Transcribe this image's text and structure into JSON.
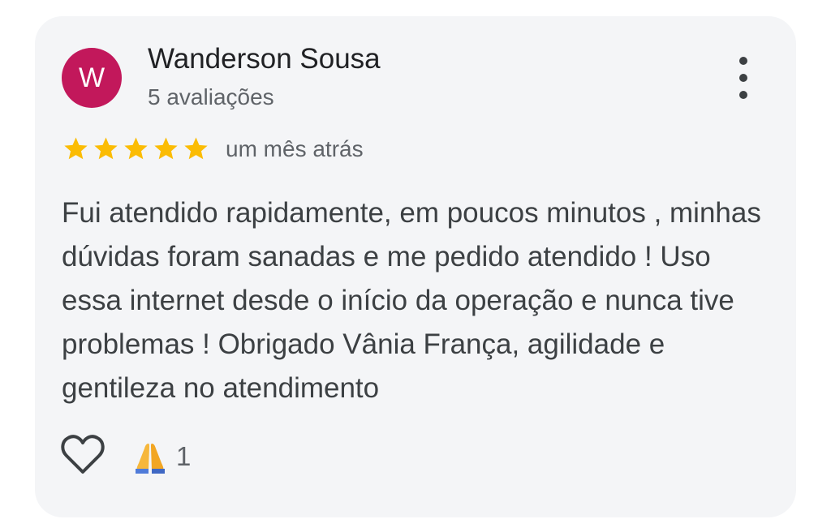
{
  "review": {
    "author": {
      "name": "Wanderson Sousa",
      "initial": "W",
      "review_count": "5 avaliações",
      "avatar_color": "#c2185b"
    },
    "rating": 5,
    "star_color": "#fbbc04",
    "time_ago": "um mês atrás",
    "text": "Fui atendido rapidamente, em poucos minutos , minhas dúvidas foram sanadas e me pedido atendido ! Uso essa internet desde o início da operação e nunca tive problemas ! Obrigado Vânia França, agilidade e gentileza no atendimento",
    "actions": {
      "like_icon": "heart-outline-icon",
      "reaction_icon": "folded-hands-icon",
      "reaction_count": "1"
    },
    "menu_icon": "more-vertical-icon"
  }
}
